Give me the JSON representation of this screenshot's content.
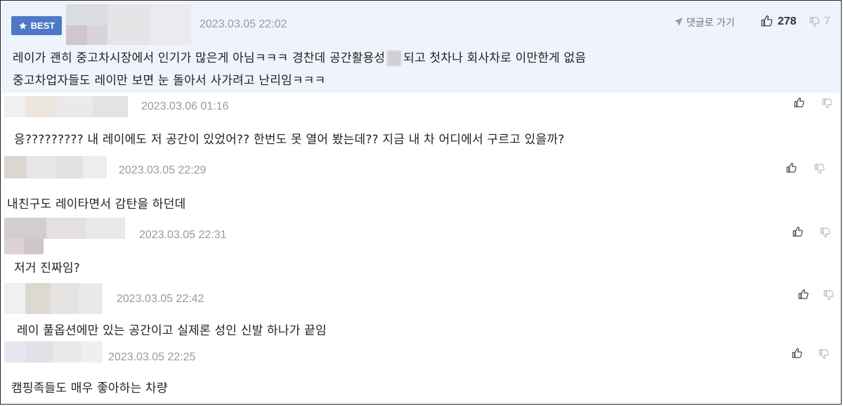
{
  "best_comment": {
    "badge_label": "BEST",
    "date": "2023.03.05 22:02",
    "reply_link": "댓글로 가기",
    "like_count": "278",
    "dislike_count": "7",
    "line1_a": "레이가 괜히 중고차시장에서 인기가 많은게 아님ㅋㅋㅋ 경찬데 공간활용성",
    "line1_b": "되고 첫차나 회사차로 이만한게 없음",
    "line2": "중고차업자들도 레이만 보면 눈 돌아서 사가려고 난리임ㅋㅋㅋ"
  },
  "comments": [
    {
      "date": "2023.03.06 01:16",
      "text": "응????????? 내 레이에도 저 공간이 있었어?? 한번도 못 열어 봤는데?? 지금 내 차 어디에서 구르고 있을까?"
    },
    {
      "date": "2023.03.05 22:29",
      "text": "내친구도 레이타면서 감탄을 하던데"
    },
    {
      "date": "2023.03.05 22:31",
      "text": "저거 진짜임?"
    },
    {
      "date": "2023.03.05 22:42",
      "text": "레이 풀옵션에만 있는 공간이고 실제론 성인 신발 하나가 끝임"
    },
    {
      "date": "2023.03.05 22:25",
      "text": "캠핑족들도 매우 좋아하는 차량"
    }
  ],
  "colors": {
    "best_bg": "#eef3fc",
    "badge": "#4d79c7",
    "date": "#9a9a9a",
    "text": "#222222"
  },
  "icons": [
    "star-icon",
    "reply-arrow-icon",
    "thumbs-up-icon",
    "thumbs-down-icon",
    "avatar-blur"
  ]
}
